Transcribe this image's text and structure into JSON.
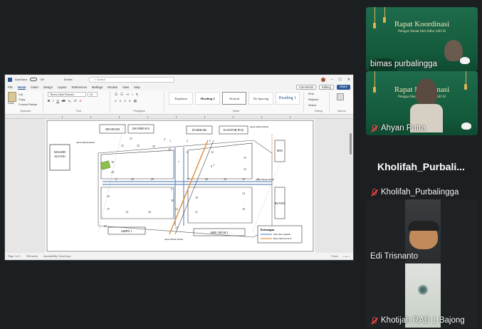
{
  "word": {
    "autosave_label": "AutoSave",
    "autosave_state": "Off",
    "doc_name": "Denah",
    "search_placeholder": "Search",
    "menu": [
      "File",
      "Home",
      "Insert",
      "Design",
      "Layout",
      "References",
      "Mailings",
      "Review",
      "View",
      "Help"
    ],
    "active_menu": "Home",
    "comments_label": "Comments",
    "editing_label": "Editing",
    "share_label": "Share",
    "ribbon": {
      "paste_label": "Paste",
      "cut_label": "Cut",
      "copy_label": "Copy",
      "format_painter_label": "Format Painter",
      "clipboard_group": "Clipboard",
      "font_name": "Times New Roman",
      "font_size": "12",
      "font_group": "Font",
      "paragraph_group": "Paragraph",
      "styles_group": "Styles",
      "styles": [
        "Emphasis",
        "Heading 2",
        "Normal",
        "No Spacing",
        "Heading 1"
      ],
      "find_label": "Find",
      "replace_label": "Replace",
      "select_label": "Select",
      "editing_group": "Editing",
      "addin_label": "Add-ins"
    },
    "status": {
      "page": "Page 1 of 1",
      "words": "255 words",
      "accessibility": "Accessibility: Good to go",
      "focus": "Focus"
    },
    "map": {
      "masjid": "MASJID AGUNG",
      "museum": "MUSEUM",
      "perpus": "DIS PERPUSTA",
      "damkar": "DAMKAR",
      "kantor_pos": "KANTOR POS",
      "bni": "BNI",
      "rutan": "RUTAN",
      "smpn": "SMPN 1",
      "smu": "SMU MUSLI",
      "akses_label": "Akses Masuk Jamaah",
      "legend_title": "Keterangan",
      "legend_1": "Jalur akses jamaah",
      "legend_2": "Batas Shaf LK & Pr",
      "numbers": [
        "1",
        "2",
        "3",
        "4",
        "5",
        "6",
        "7",
        "8",
        "9",
        "10",
        "11",
        "12",
        "13",
        "14",
        "15",
        "16",
        "17",
        "18",
        "19",
        "20",
        "21",
        "22",
        "23",
        "24",
        "25",
        "26",
        "27",
        "28",
        "29",
        "30",
        "31",
        "32",
        "33",
        "34",
        "35"
      ]
    }
  },
  "participants": [
    {
      "name": "bimas purbalingga",
      "muted": false,
      "banner_title": "Rapat Koordinasi",
      "banner_sub": "Petugas Sholat Idul Adha 1445 H"
    },
    {
      "name": "Ahyan Putra",
      "muted": true,
      "banner_title": "Rapat Koordinasi",
      "banner_sub": "Petugas Sholat Idul Adha 1445 H"
    },
    {
      "name": "Kholifah_Purbalingga",
      "muted": true,
      "display_name": "Kholifah_Purbali..."
    },
    {
      "name": "Edi Trisnanto",
      "muted": false
    },
    {
      "name": "Khotijah RAD 1 Bajong",
      "muted": true
    }
  ]
}
